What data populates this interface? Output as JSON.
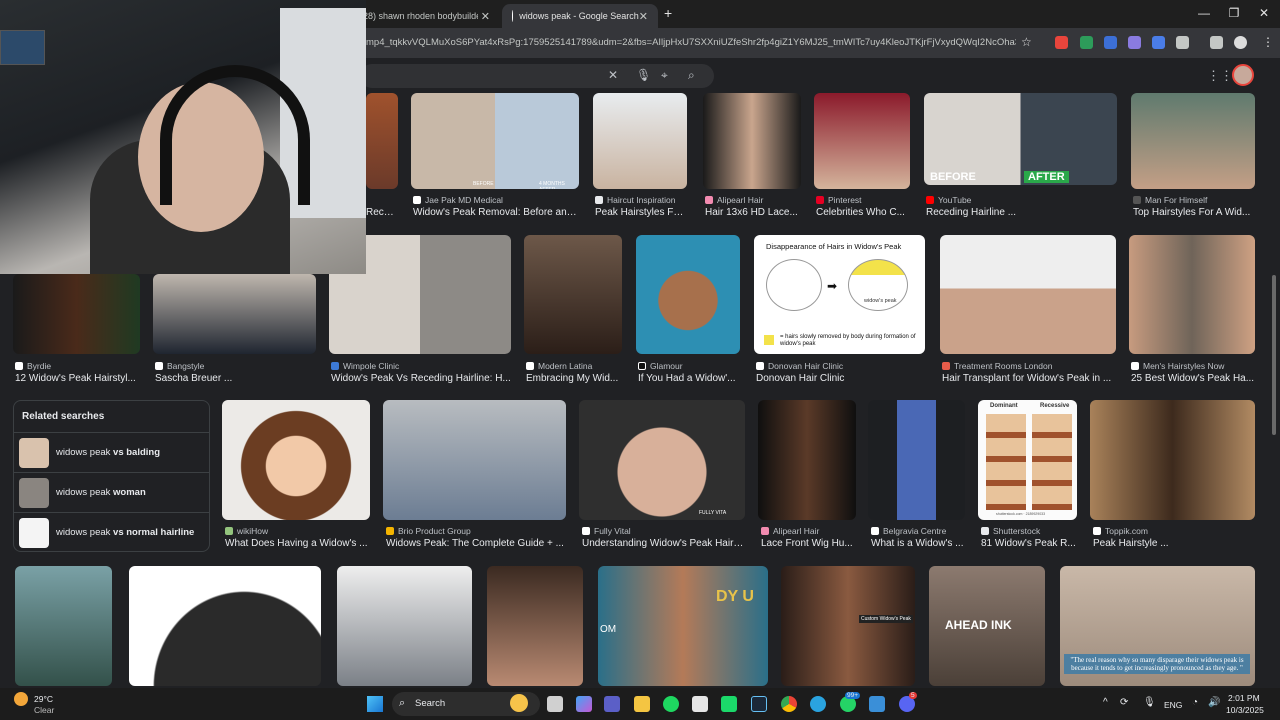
{
  "browser": {
    "tabs": [
      {
        "label": "(28) shawn rhoden bodybuilder"
      },
      {
        "label": "widows peak - Google Search"
      }
    ],
    "url": "mp4_tqkkvVQLMuXoS6PYat4xRsPg:1759525141789&udm=2&fbs=AIljpHxU7SXXniUZfeShr2fp4giZ1Y6MJ25_tmWITc7uy4KleoJTKjrFjVxydQWqI2NcOha3O1Yq...",
    "new_tab_icon": "plus-icon"
  },
  "search": {
    "clear_icon": "close-icon",
    "voice_icon": "mic-icon",
    "lens_icon": "camera-icon",
    "search_icon": "search-icon"
  },
  "row1": [
    {
      "source": "",
      "caption": "Recedi..."
    },
    {
      "source": "Jae Pak MD Medical",
      "caption": "Widow's Peak Removal: Before and...",
      "overlay_left": "BEFORE",
      "overlay_right": "4 MONTHS AFTER"
    },
    {
      "source": "Haircut Inspiration",
      "caption": "Peak Hairstyles Fo..."
    },
    {
      "source": "Alipearl Hair",
      "caption": "Hair 13x6 HD Lace..."
    },
    {
      "source": "Pinterest",
      "caption": "Celebrities Who C..."
    },
    {
      "source": "YouTube",
      "caption": "Receding Hairline ...",
      "overlay_left": "BEFORE",
      "overlay_right": "AFTER"
    },
    {
      "source": "Man For Himself",
      "caption": "Top Hairstyles For A Wid..."
    }
  ],
  "row2": [
    {
      "source": "Byrdie",
      "caption": "12 Widow's Peak Hairstyl..."
    },
    {
      "source": "Bangstyle",
      "caption": "Sascha Breuer ..."
    },
    {
      "source": "Wimpole Clinic",
      "caption": "Widow's Peak Vs Receding Hairline: H..."
    },
    {
      "source": "Modern Latina",
      "caption": "Embracing My Wid..."
    },
    {
      "source": "Glamour",
      "caption": "If You Had a Widow'..."
    },
    {
      "source": "Donovan Hair Clinic",
      "caption": "Donovan Hair Clinic",
      "diagram_title": "Disappearance of Hairs in Widow's Peak",
      "diagram_label": "widow's peak",
      "diagram_note": "= hairs slowly removed by body during formation of widow's peak"
    },
    {
      "source": "Treatment Rooms London",
      "caption": "Hair Transplant for Widow's Peak in ..."
    },
    {
      "source": "Men's Hairstyles Now",
      "caption": "25 Best Widow's Peak Ha..."
    }
  ],
  "related": {
    "title": "Related searches",
    "items": [
      {
        "prefix": "widows peak ",
        "bold": "vs balding"
      },
      {
        "prefix": "widows peak ",
        "bold": "woman"
      },
      {
        "prefix": "widows peak ",
        "bold": "vs normal hairline"
      }
    ]
  },
  "row3": [
    {
      "source": "wikiHow",
      "caption": "What Does Having a Widow's ..."
    },
    {
      "source": "Brio Product Group",
      "caption": "Widows Peak: The Complete Guide + ..."
    },
    {
      "source": "Fully Vital",
      "caption": "Understanding Widow's Peak Hairli...",
      "watermark": "FULLY VITA"
    },
    {
      "source": "Alipearl Hair",
      "caption": "Lace Front Wig Hu..."
    },
    {
      "source": "Belgravia Centre",
      "caption": "What is a Widow's ..."
    },
    {
      "source": "Shutterstock",
      "caption": "81 Widow's Peak R...",
      "chart_left": "Dominant",
      "chart_right": "Recessive",
      "id_text": "shutterstock.com · 2189929033"
    },
    {
      "source": "Toppik.com",
      "caption": "Peak Hairstyle ..."
    }
  ],
  "row4": [
    {
      "overlay": ""
    },
    {
      "overlay": ""
    },
    {
      "overlay": ""
    },
    {
      "overlay": ""
    },
    {
      "overlay": "DY U",
      "overlay2": "OM"
    },
    {
      "overlay": "Custom Widow's Peak"
    },
    {
      "overlay": "AHEAD INK"
    },
    {
      "overlay": "\"The real reason why so many disparage their widows peak is because it tends to get increasingly pronounced as they age. \""
    }
  ],
  "taskbar": {
    "weather_temp": "29°C",
    "weather_desc": "Clear",
    "search_label": "Search",
    "lang": "ENG",
    "time": "2:01 PM",
    "date": "10/3/2025",
    "badge_whatsapp": "99+",
    "badge_discord": "5"
  },
  "colors": {
    "page_bg": "#202124",
    "tab_bg": "#1f1f1f",
    "active_tab": "#35363a",
    "source_text": "#bdc1c6",
    "caption_text": "#e8eaed"
  }
}
